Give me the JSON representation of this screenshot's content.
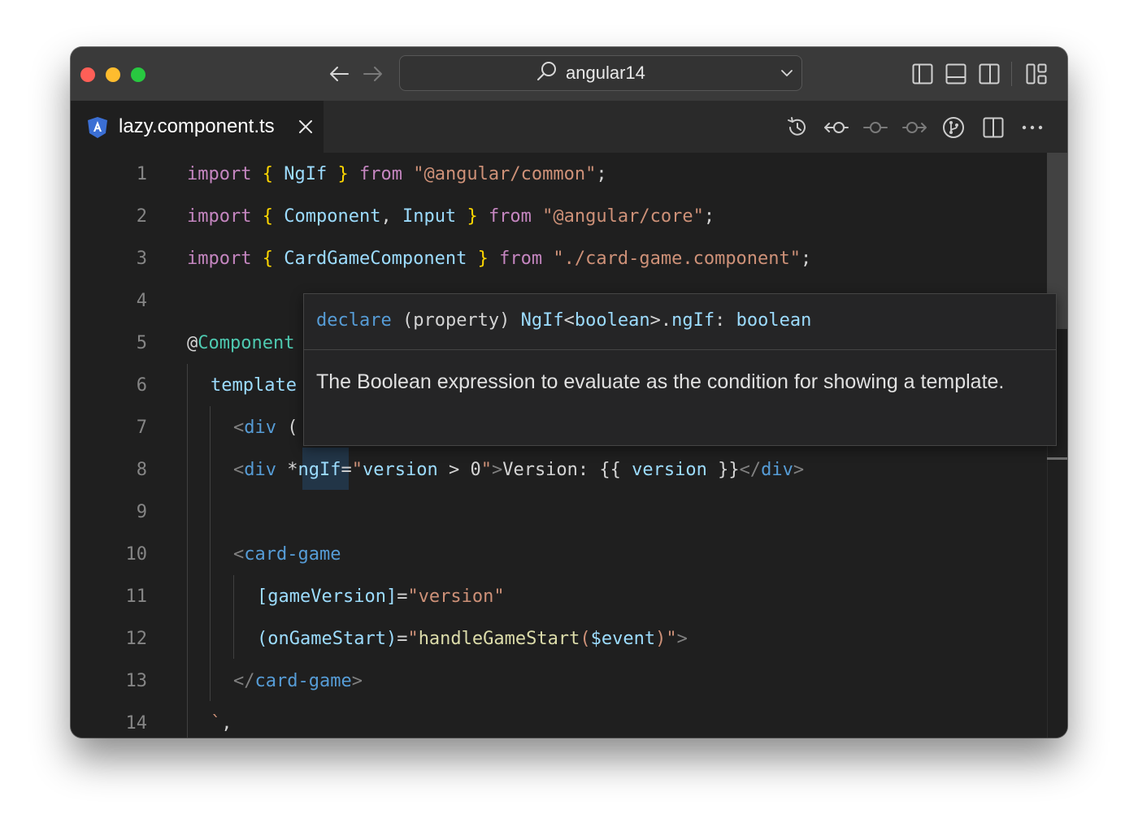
{
  "titlebar": {
    "search_text": "angular14",
    "back_label": "←",
    "forward_label": "→"
  },
  "tab": {
    "label": "lazy.component.ts",
    "close_glyph": "✕"
  },
  "editor": {
    "line_numbers": [
      "1",
      "2",
      "3",
      "4",
      "5",
      "6",
      "7",
      "8",
      "9",
      "10",
      "11",
      "12",
      "13",
      "14"
    ],
    "lines": {
      "l1": [
        {
          "t": "import",
          "c": "kw"
        },
        {
          "t": " "
        },
        {
          "t": "{",
          "c": "br"
        },
        {
          "t": " "
        },
        {
          "t": "NgIf",
          "c": "id"
        },
        {
          "t": " "
        },
        {
          "t": "}",
          "c": "br"
        },
        {
          "t": " "
        },
        {
          "t": "from",
          "c": "kw"
        },
        {
          "t": " "
        },
        {
          "t": "\"@angular/common\"",
          "c": "str"
        },
        {
          "t": ";"
        }
      ],
      "l2": [
        {
          "t": "import",
          "c": "kw"
        },
        {
          "t": " "
        },
        {
          "t": "{",
          "c": "br"
        },
        {
          "t": " "
        },
        {
          "t": "Component",
          "c": "id"
        },
        {
          "t": ", "
        },
        {
          "t": "Input",
          "c": "id"
        },
        {
          "t": " "
        },
        {
          "t": "}",
          "c": "br"
        },
        {
          "t": " "
        },
        {
          "t": "from",
          "c": "kw"
        },
        {
          "t": " "
        },
        {
          "t": "\"@angular/core\"",
          "c": "str"
        },
        {
          "t": ";"
        }
      ],
      "l3": [
        {
          "t": "import",
          "c": "kw"
        },
        {
          "t": " "
        },
        {
          "t": "{",
          "c": "br"
        },
        {
          "t": " "
        },
        {
          "t": "CardGameComponent",
          "c": "id"
        },
        {
          "t": " "
        },
        {
          "t": "}",
          "c": "br"
        },
        {
          "t": " "
        },
        {
          "t": "from",
          "c": "kw"
        },
        {
          "t": " "
        },
        {
          "t": "\"./card-game.component\"",
          "c": "str"
        },
        {
          "t": ";"
        }
      ],
      "l5": [
        {
          "t": "@",
          "c": "txt"
        },
        {
          "t": "Component",
          "c": "dec"
        }
      ],
      "l6": [
        {
          "t": "template",
          "c": "id"
        }
      ],
      "l7": [
        {
          "t": "<",
          "c": "pu"
        },
        {
          "t": "div",
          "c": "tag"
        },
        {
          "t": " ("
        }
      ],
      "l8": [
        {
          "t": "<",
          "c": "pu"
        },
        {
          "t": "div",
          "c": "tag"
        },
        {
          "t": " *"
        },
        {
          "t": "ngIf",
          "c": "id"
        },
        {
          "t": "="
        },
        {
          "t": "\"",
          "c": "strg"
        },
        {
          "t": "version",
          "c": "id"
        },
        {
          "t": " > "
        },
        {
          "t": "0",
          "c": "txt"
        },
        {
          "t": "\"",
          "c": "strg"
        },
        {
          "t": ">",
          "c": "pu"
        },
        {
          "t": "Version: "
        },
        {
          "t": "{{ "
        },
        {
          "t": "version",
          "c": "id"
        },
        {
          "t": " }}"
        },
        {
          "t": "</",
          "c": "pu"
        },
        {
          "t": "div",
          "c": "tag"
        },
        {
          "t": ">",
          "c": "pu"
        }
      ],
      "l10": [
        {
          "t": "<",
          "c": "pu"
        },
        {
          "t": "card-game",
          "c": "tag"
        }
      ],
      "l11": [
        {
          "t": "[gameVersion]",
          "c": "id"
        },
        {
          "t": "="
        },
        {
          "t": "\"version\"",
          "c": "strg"
        }
      ],
      "l12": [
        {
          "t": "(onGameStart)",
          "c": "id"
        },
        {
          "t": "="
        },
        {
          "t": "\"",
          "c": "strg"
        },
        {
          "t": "handleGameStart",
          "c": "fn"
        },
        {
          "t": "(",
          "c": "strg"
        },
        {
          "t": "$event",
          "c": "id"
        },
        {
          "t": ")\"",
          "c": "strg"
        },
        {
          "t": ">",
          "c": "pu"
        }
      ],
      "l13": [
        {
          "t": "</",
          "c": "pu"
        },
        {
          "t": "card-game",
          "c": "tag"
        },
        {
          "t": ">",
          "c": "pu"
        }
      ],
      "l14": [
        {
          "t": "`",
          "c": "tmpl"
        },
        {
          "t": ","
        }
      ]
    }
  },
  "hover": {
    "signature": [
      {
        "t": "declare",
        "c": "blue"
      },
      {
        "t": " (property) "
      },
      {
        "t": "NgIf",
        "c": "id"
      },
      {
        "t": "<"
      },
      {
        "t": "boolean",
        "c": "id"
      },
      {
        "t": ">."
      },
      {
        "t": "ngIf",
        "c": "id"
      },
      {
        "t": ": "
      },
      {
        "t": "boolean",
        "c": "id"
      }
    ],
    "doc": "The Boolean expression to evaluate as the condition for showing a template."
  },
  "icons": {
    "traffic_lights": [
      "close-window-icon",
      "minimize-window-icon",
      "zoom-window-icon"
    ],
    "layout": [
      "toggle-primary-sidebar-icon",
      "toggle-panel-icon",
      "toggle-secondary-sidebar-icon",
      "customize-layout-icon"
    ],
    "editor_actions": [
      "timeline-history-icon",
      "previous-change-icon",
      "current-change-icon",
      "next-change-icon",
      "source-control-icon",
      "split-editor-icon",
      "more-actions-icon"
    ]
  },
  "colors": {
    "keyword": "#c586c0",
    "bracket": "#ffd700",
    "identifier": "#9cdcfe",
    "string": "#ce9178",
    "tag": "#569cd6",
    "decorator": "#4ec9b0",
    "function": "#dcdcaa",
    "angular_badge": "#3b6fd4"
  }
}
